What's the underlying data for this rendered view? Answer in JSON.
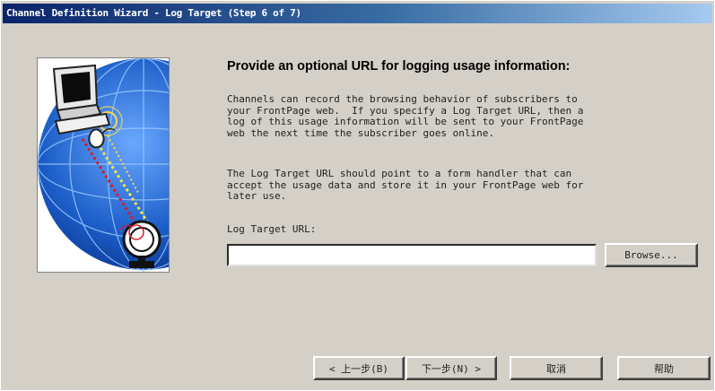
{
  "window": {
    "title": "Channel Definition Wizard - Log Target (Step 6 of 7)"
  },
  "content": {
    "heading": "Provide an optional URL for logging usage information:",
    "paragraph1": "Channels can record the browsing behavior of subscribers to\nyour FrontPage web.  If you specify a Log Target URL, then a\nlog of this usage information will be sent to your FrontPage\nweb the next time the subscriber goes online.",
    "paragraph2": "The Log Target URL should point to a form handler that can\naccept the usage data and store it in your FrontPage web for\nlater use.",
    "field_label": "Log Target URL:",
    "field_value": "",
    "browse_label": "Browse..."
  },
  "buttons": {
    "back": "< 上一步(B)",
    "next": "下一步(N) >",
    "cancel": "取消",
    "help": "帮助"
  },
  "colors": {
    "dialog_face": "#d4d0c8",
    "titlebar_start": "#0a246a",
    "titlebar_end": "#a6caf0",
    "globe_blue": "#1c5fc8"
  },
  "illustration": {
    "icons": [
      "computer-icon",
      "mouse-icon",
      "globe-icon",
      "satellite-dish-icon"
    ]
  }
}
